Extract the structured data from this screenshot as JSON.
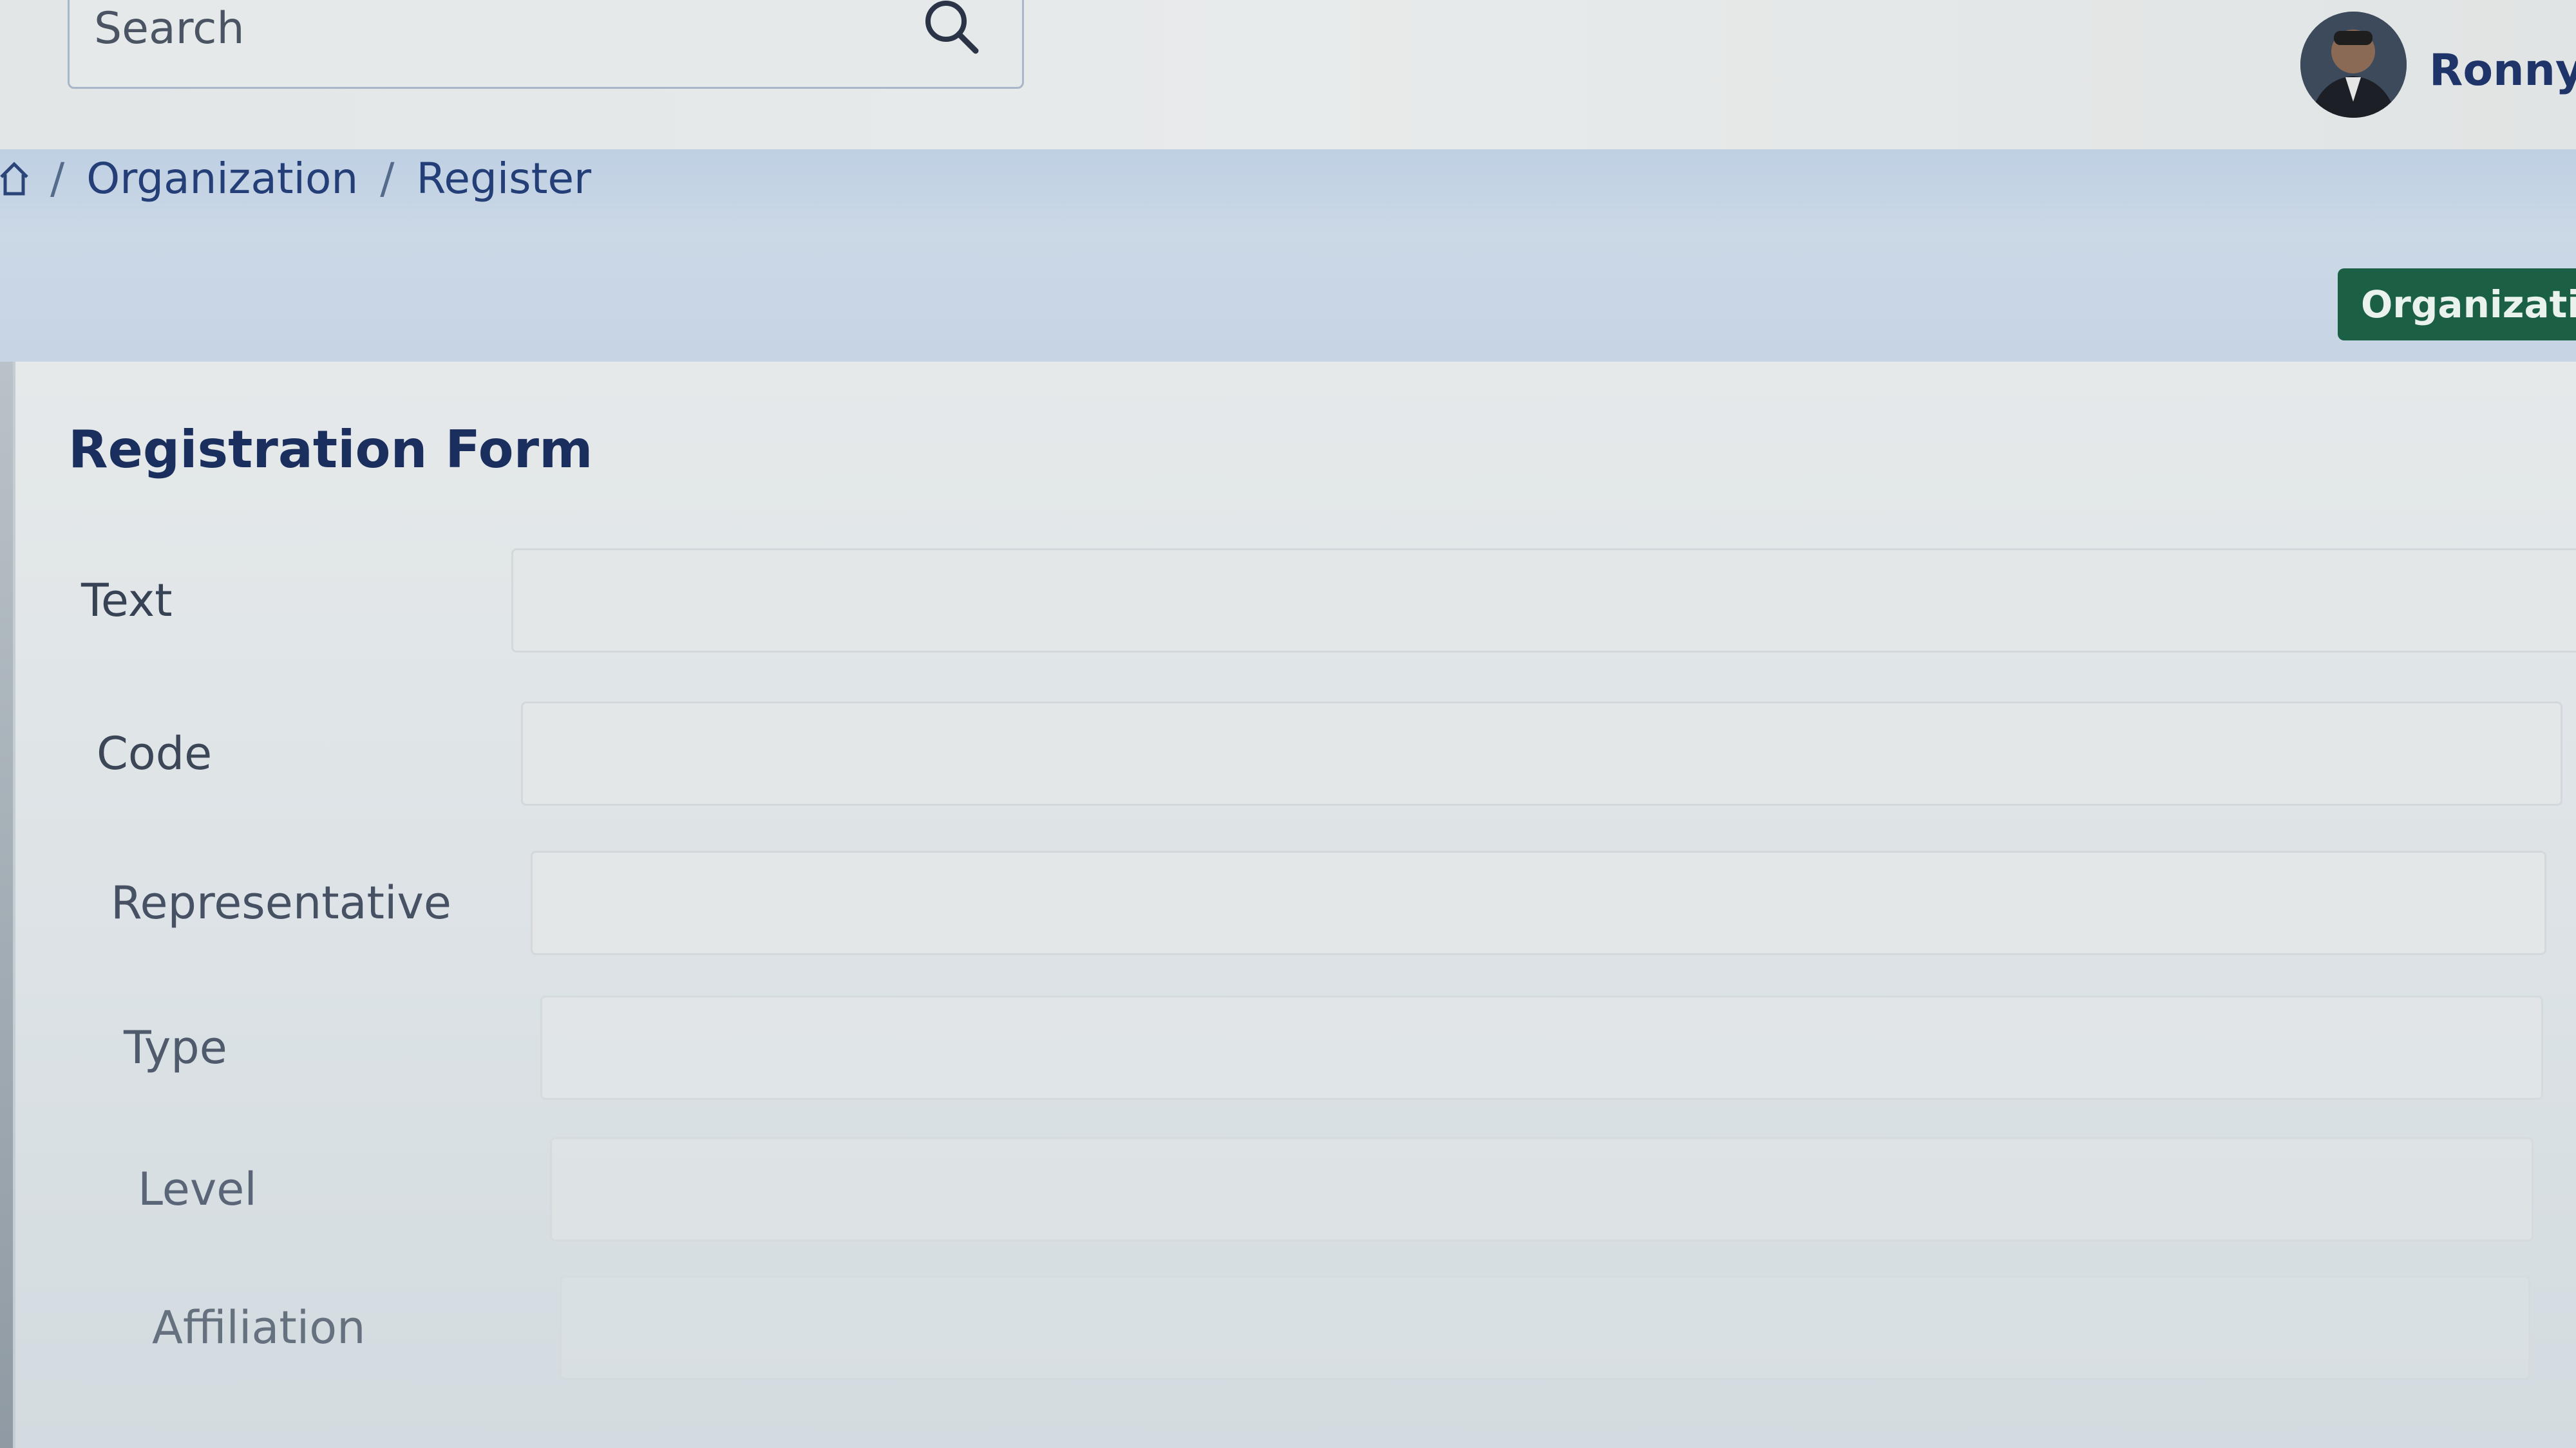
{
  "header": {
    "search": {
      "placeholder": "Search"
    },
    "user": {
      "name": "Ronny I"
    }
  },
  "breadcrumb": {
    "items": [
      "Organization",
      "Register"
    ],
    "separator": "/"
  },
  "band": {
    "action_button_label": "Organization"
  },
  "form": {
    "title": "Registration Form",
    "fields": [
      {
        "label": "Text",
        "value": ""
      },
      {
        "label": "Code",
        "value": ""
      },
      {
        "label": "Representative",
        "value": ""
      },
      {
        "label": "Type",
        "value": ""
      },
      {
        "label": "Level",
        "value": ""
      },
      {
        "label": "Affiliation",
        "value": ""
      }
    ]
  },
  "icons": {
    "search": "search-icon",
    "home": "home-icon",
    "avatar": "user-avatar"
  },
  "colors": {
    "accent_button": "#1b5f45",
    "title_text": "#1b2f5f",
    "breadcrumb_text": "#243f77"
  }
}
